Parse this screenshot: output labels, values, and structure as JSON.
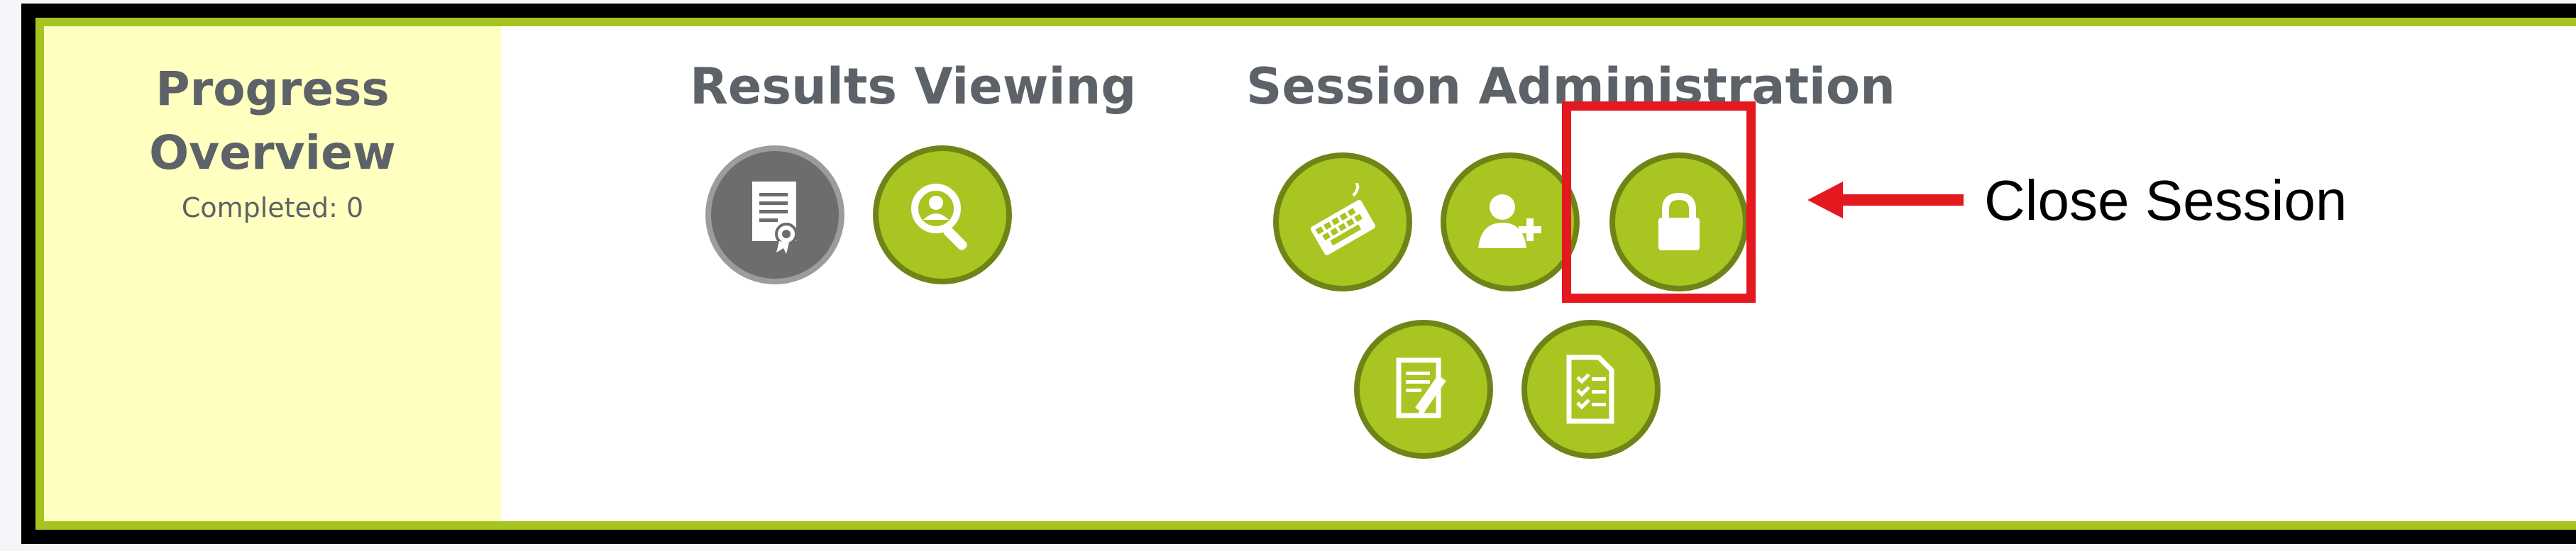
{
  "progress": {
    "title_line1": "Progress",
    "title_line2": "Overview",
    "completed": "Completed: 0"
  },
  "results": {
    "title": "Results Viewing",
    "buttons": [
      {
        "icon": "certificate-document-icon",
        "color": "#6d6d6d"
      },
      {
        "icon": "user-search-icon",
        "color": "#a9c521"
      }
    ]
  },
  "session": {
    "title": "Session Administration",
    "buttons": [
      {
        "icon": "keyboard-icon"
      },
      {
        "icon": "add-user-icon"
      },
      {
        "icon": "lock-icon"
      },
      {
        "icon": "edit-document-icon"
      },
      {
        "icon": "checklist-icon"
      }
    ]
  },
  "annotation": {
    "label": "Close Session",
    "highlight_color": "#e4191f"
  },
  "colors": {
    "accent": "#a9c521",
    "panel_highlight": "#ffffc0",
    "text": "#5d6268"
  }
}
